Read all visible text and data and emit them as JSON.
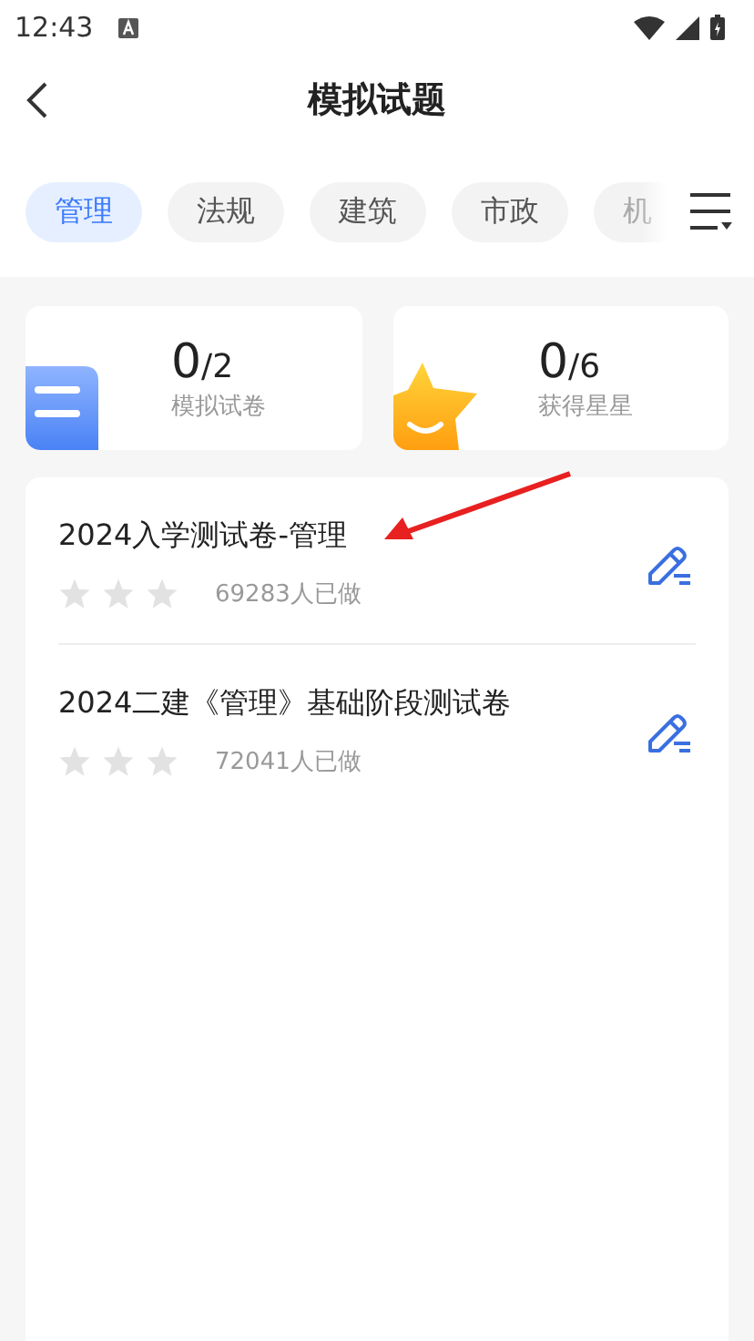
{
  "status_bar": {
    "time": "12:43"
  },
  "header": {
    "title": "模拟试题"
  },
  "tabs": [
    {
      "label": "管理",
      "selected": true
    },
    {
      "label": "法规",
      "selected": false
    },
    {
      "label": "建筑",
      "selected": false
    },
    {
      "label": "市政",
      "selected": false
    },
    {
      "label": "机",
      "selected": false
    }
  ],
  "stats": [
    {
      "kind": "papers",
      "done": "0",
      "total": "/2",
      "label": "模拟试卷"
    },
    {
      "kind": "stars",
      "done": "0",
      "total": "/6",
      "label": "获得星星"
    }
  ],
  "papers": [
    {
      "title": "2024入学测试卷-管理",
      "stars": 0,
      "count": "69283人已做"
    },
    {
      "title": "2024二建《管理》基础阶段测试卷",
      "stars": 0,
      "count": "72041人已做"
    }
  ]
}
